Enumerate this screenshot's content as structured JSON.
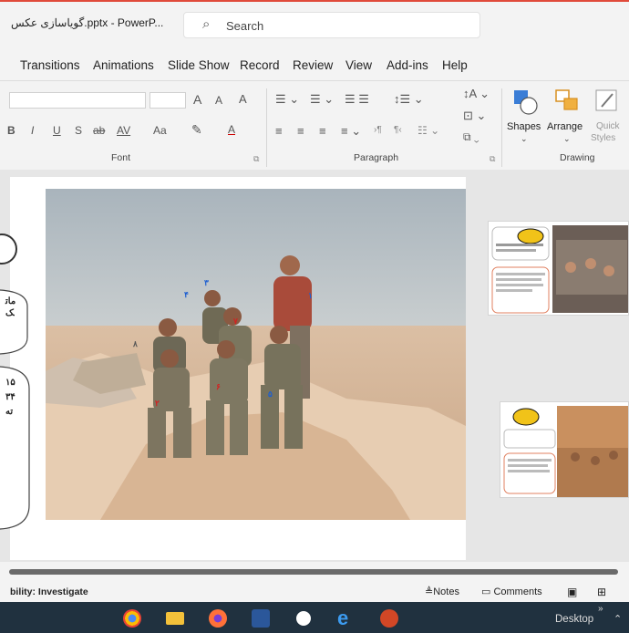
{
  "window": {
    "title": "گویاسازی عکس.pptx - PowerP..."
  },
  "search": {
    "placeholder": "Search"
  },
  "tabs": [
    "Transitions",
    "Animations",
    "Slide Show",
    "Record",
    "Review",
    "View",
    "Add-ins",
    "Help"
  ],
  "ribbon": {
    "font_group_label": "Font",
    "paragraph_group_label": "Paragraph",
    "drawing_group_label": "Drawing",
    "font_buttons": {
      "bold": "B",
      "italic": "I",
      "underline": "U",
      "strike": "S",
      "strike2": "ab",
      "spacing": "AV",
      "case": "Aa",
      "grow": "A",
      "shrink": "A",
      "clear": "A"
    },
    "shapes_label": "Shapes",
    "arrange_label": "Arrange",
    "quick_styles_label_1": "Quick",
    "quick_styles_label_2": "Styles"
  },
  "status": {
    "accessibility": "bility: Investigate",
    "notes": "Notes",
    "comments": "Comments"
  },
  "taskbar": {
    "desktop_label": "Desktop"
  },
  "left_pane": {
    "frag1": "ماتک",
    "frag2": "۱۵۳۴ ته"
  },
  "slide": {
    "markers": [
      "۱",
      "۲",
      "۳",
      "۴",
      "۵",
      "۶",
      "۷",
      "۸"
    ]
  },
  "colors": {
    "accent": "#c43e1c",
    "marker_blue": "#1e5fd0",
    "marker_red": "#d42020"
  }
}
